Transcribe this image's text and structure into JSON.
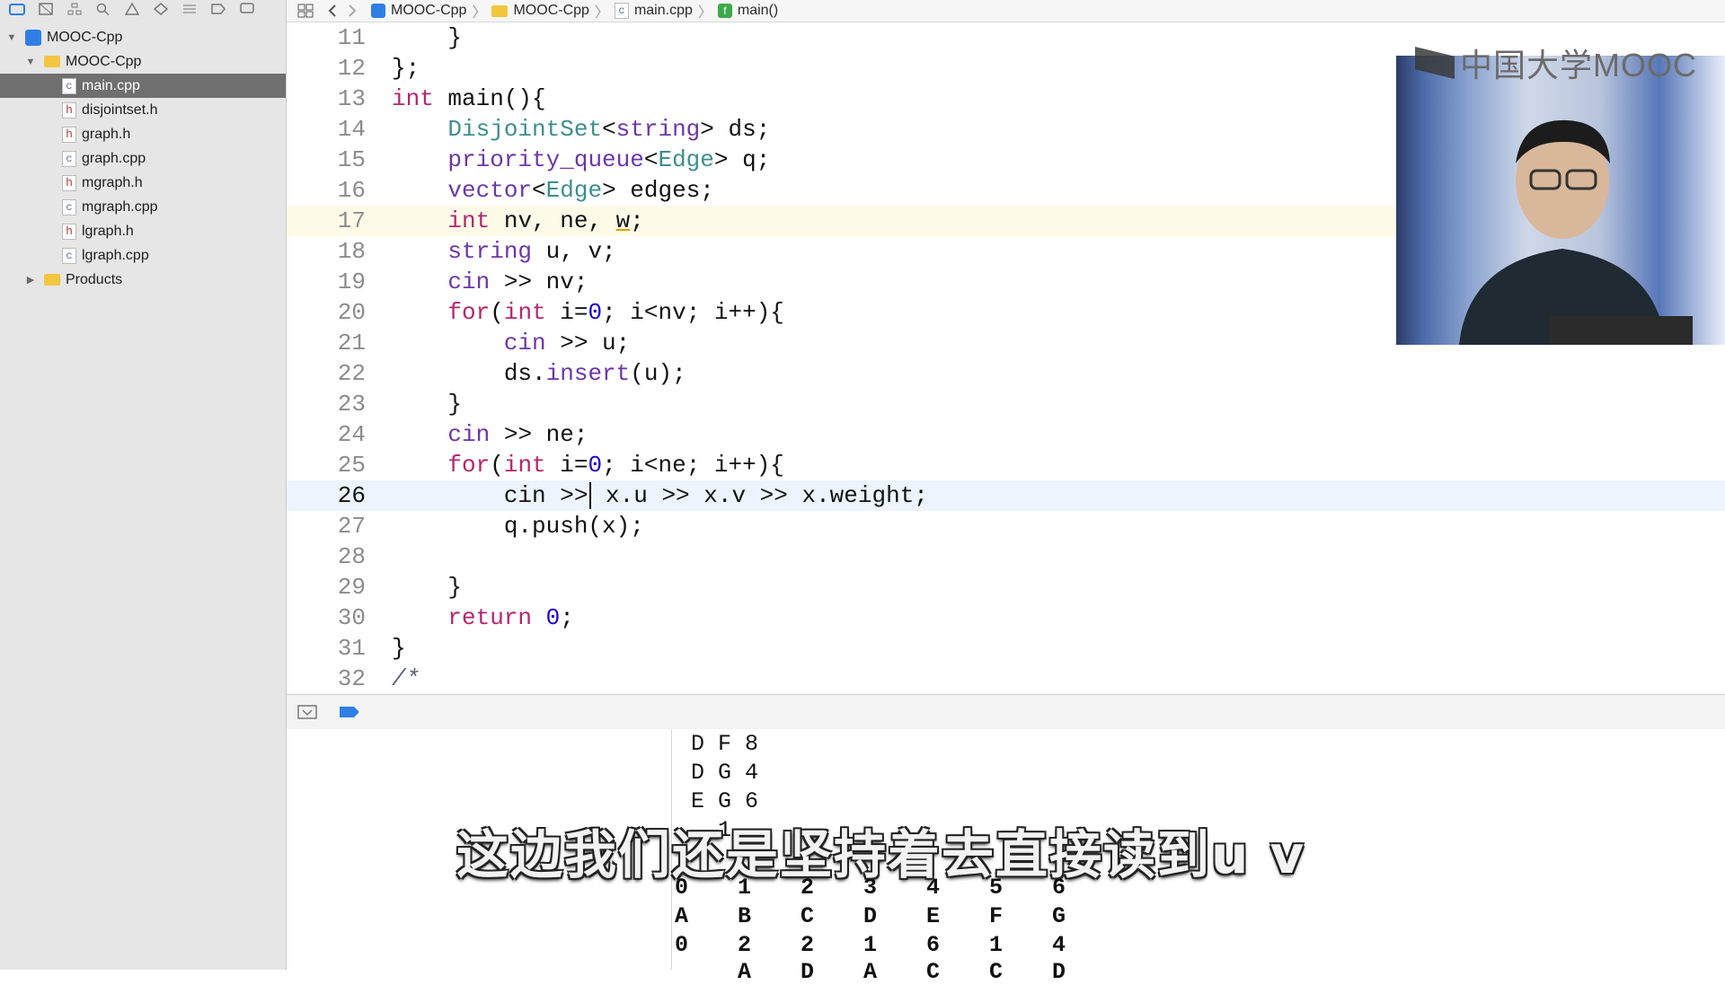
{
  "toolbar": {
    "icons": [
      "folder-icon",
      "source-control-icon",
      "hierarchy-icon",
      "search-icon",
      "warning-icon",
      "test-icon",
      "debug-icon",
      "breakpoint-icon",
      "report-icon"
    ]
  },
  "sidebar": {
    "project": "MOOC-Cpp",
    "group": "MOOC-Cpp",
    "files": [
      {
        "name": "main.cpp",
        "kind": "cpp",
        "selected": true
      },
      {
        "name": "disjointset.h",
        "kind": "h"
      },
      {
        "name": "graph.h",
        "kind": "h"
      },
      {
        "name": "graph.cpp",
        "kind": "cpp"
      },
      {
        "name": "mgraph.h",
        "kind": "h"
      },
      {
        "name": "mgraph.cpp",
        "kind": "cpp"
      },
      {
        "name": "lgraph.h",
        "kind": "h"
      },
      {
        "name": "lgraph.cpp",
        "kind": "cpp"
      }
    ],
    "products": "Products"
  },
  "jumpbar": {
    "project": "MOOC-Cpp",
    "group": "MOOC-Cpp",
    "file": "main.cpp",
    "symbol": "main()"
  },
  "editor": {
    "lines": [
      {
        "n": "11",
        "text": "    }"
      },
      {
        "n": "12",
        "text": "};"
      },
      {
        "n": "13",
        "text": "int main(){"
      },
      {
        "n": "14",
        "text": "    DisjointSet<string> ds;"
      },
      {
        "n": "15",
        "text": "    priority_queue<Edge> q;"
      },
      {
        "n": "16",
        "text": "    vector<Edge> edges;"
      },
      {
        "n": "17",
        "text": "    int nv, ne, w;"
      },
      {
        "n": "18",
        "text": "    string u, v;"
      },
      {
        "n": "19",
        "text": "    cin >> nv;"
      },
      {
        "n": "20",
        "text": "    for(int i=0; i<nv; i++){"
      },
      {
        "n": "21",
        "text": "        cin >> u;"
      },
      {
        "n": "22",
        "text": "        ds.insert(u);"
      },
      {
        "n": "23",
        "text": "    }"
      },
      {
        "n": "24",
        "text": "    cin >> ne;"
      },
      {
        "n": "25",
        "text": "    for(int i=0; i<ne; i++){"
      },
      {
        "n": "26",
        "text": "        cin >>| x.u >> x.v >> x.weight;"
      },
      {
        "n": "27",
        "text": "        q.push(x);"
      },
      {
        "n": "28",
        "text": ""
      },
      {
        "n": "29",
        "text": "    }"
      },
      {
        "n": "30",
        "text": "    return 0;"
      },
      {
        "n": "31",
        "text": "}"
      },
      {
        "n": "32",
        "text": "/*"
      }
    ]
  },
  "console": {
    "lines": [
      "D F 8",
      "D G 4",
      "E G 6",
      "  1"
    ],
    "table": [
      [
        "0",
        "1",
        "2",
        "3",
        "4",
        "5",
        "6"
      ],
      [
        "A",
        "B",
        "C",
        "D",
        "E",
        "F",
        "G"
      ],
      [
        "0",
        "2",
        "2",
        "1",
        "6",
        "1",
        "4"
      ],
      [
        "",
        "A",
        "D",
        "A",
        "C",
        "C",
        "D"
      ]
    ]
  },
  "subtitle": "这边我们还是坚持着去直接读到u  v",
  "overlay": {
    "logo": "中国大学MOOC"
  },
  "colors": {
    "keyword": "#b4266e",
    "type": "#3d8e8e",
    "function": "#6c36a9",
    "number": "#1c00cf",
    "selection": "#6f6f6f"
  }
}
